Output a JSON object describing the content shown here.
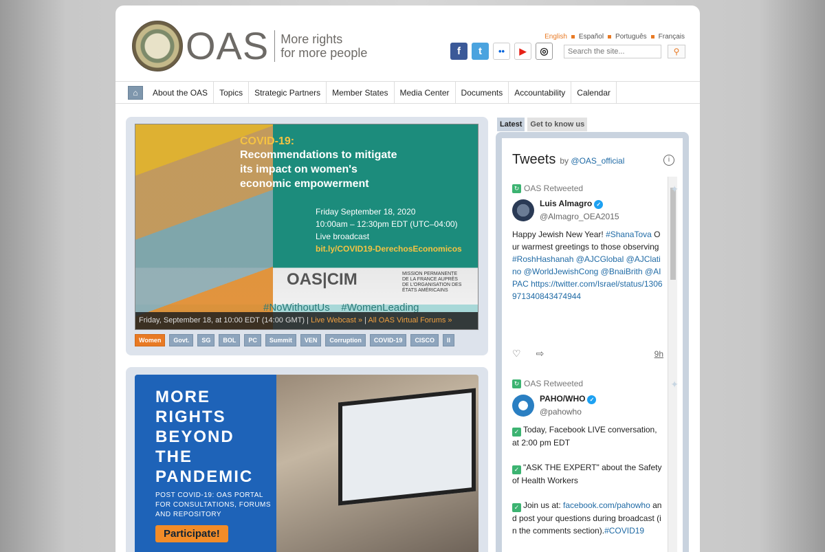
{
  "brand": {
    "acronym": "OAS",
    "tagline_line1": "More rights",
    "tagline_line2": "for more people"
  },
  "languages": [
    {
      "label": "English",
      "active": true
    },
    {
      "label": "Español"
    },
    {
      "label": "Português"
    },
    {
      "label": "Français"
    }
  ],
  "socials": [
    {
      "name": "facebook-icon",
      "glyph": "f"
    },
    {
      "name": "twitter-icon",
      "glyph": "t"
    },
    {
      "name": "flickr-icon",
      "glyph": "••"
    },
    {
      "name": "youtube-icon",
      "glyph": "▶"
    },
    {
      "name": "instagram-icon",
      "glyph": "◎"
    }
  ],
  "search": {
    "placeholder": "Search the site..."
  },
  "nav": {
    "items": [
      "About the OAS",
      "Topics",
      "Strategic Partners",
      "Member States",
      "Media Center",
      "Documents",
      "Accountability",
      "Calendar"
    ]
  },
  "banner1": {
    "heading_highlight": "COVID-19:",
    "heading_line1": "Recommendations to mitigate",
    "heading_line2": "its impact on women's",
    "heading_line3": "economic empowerment",
    "date": "Friday September 18, 2020",
    "time": "10:00am – 12:30pm EDT (UTC–04:00)",
    "broadcast": "Live broadcast",
    "link": "bit.ly/COVID19-DerechosEconomicos",
    "logos": "OAS|CIM",
    "mission": "MISSION PERMANENTE DE LA FRANCE AUPRÈS DE L'ORGANISATION DES ÉTATS AMÉRICAINS",
    "hashtag1": "#NoWithoutUs",
    "hashtag2": "#WomenLeading",
    "caption_date": "Friday, September 18, at 10:00 EDT (14:00 GMT) |",
    "caption_link1": "Live Webcast »",
    "caption_sep": " | ",
    "caption_link2": "All OAS Virtual Forums »"
  },
  "tags": [
    "Women",
    "Govt.",
    "SG",
    "BOL",
    "PC",
    "Summit",
    "VEN",
    "Corruption",
    "COVID-19",
    "CISCO"
  ],
  "banner2": {
    "line1": "MORE",
    "line2": "RIGHTS",
    "line3": "BEYOND",
    "line4": "THE",
    "line5": "PANDEMIC",
    "sub": "POST COVID-19: OAS PORTAL FOR CONSULTATIONS, FORUMS AND REPOSITORY",
    "cta": "Participate!"
  },
  "right_tabs": [
    "Latest",
    "Get to know us"
  ],
  "twitter": {
    "title": "Tweets",
    "by": "by",
    "account": "@OAS_official",
    "tweets": [
      {
        "retweeted": "OAS Retweeted",
        "name": "Luis Almagro",
        "handle": "@Almagro_OEA2015",
        "text_a": "Happy Jewish New Year! ",
        "link_a": "#ShanaTova",
        "text_b": " Our warmest greetings to those observing ",
        "link_b": "#RoshHashanah @AJCGlobal @AJClatino @WorldJewishCong @BnaiBrith @AIPAC https://twitter.com/Israel/status/1306971340843474944",
        "time": "9h"
      },
      {
        "retweeted": "OAS Retweeted",
        "name": "PAHO/WHO",
        "handle": "@pahowho",
        "p1": "Today, Facebook LIVE conversation, at 2:00 pm EDT",
        "p2": "\"ASK THE EXPERT\" about the Safety of Health Workers",
        "p3a": "Join us at: ",
        "p3link": "facebook.com/pahowho",
        "p3b": " and post your questions during broadcast (in the comments section).",
        "p3tag": "#COVID19"
      }
    ]
  }
}
